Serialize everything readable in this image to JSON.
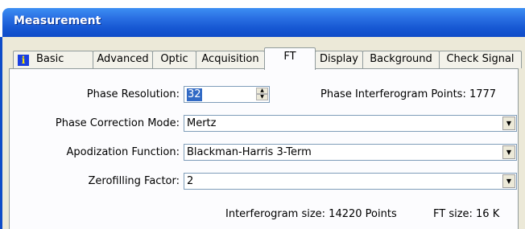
{
  "window": {
    "title": "Measurement"
  },
  "tabs": [
    {
      "label": "Basic"
    },
    {
      "label": "Advanced"
    },
    {
      "label": "Optic"
    },
    {
      "label": "Acquisition"
    },
    {
      "label": "FT"
    },
    {
      "label": "Display"
    },
    {
      "label": "Background"
    },
    {
      "label": "Check Signal"
    }
  ],
  "active_tab": "FT",
  "form": {
    "phase_resolution": {
      "label": "Phase Resolution:",
      "value": "32"
    },
    "phase_interferogram_points": "Phase Interferogram Points:  1777",
    "phase_correction_mode": {
      "label": "Phase Correction Mode:",
      "value": "Mertz"
    },
    "apodization_function": {
      "label": "Apodization Function:",
      "value": "Blackman-Harris 3-Term"
    },
    "zerofilling_factor": {
      "label": "Zerofilling Factor:",
      "value": "2"
    }
  },
  "status": {
    "interferogram_size": "Interferogram size: 14220 Points",
    "ft_size": "FT size: 16 K"
  },
  "icons": {
    "info": "i",
    "spin_up": "▲",
    "spin_down": "▼",
    "dropdown": "▼"
  },
  "colors": {
    "titlebar": "#1657d2",
    "dialog_bg": "#ece9d8",
    "panel_bg": "#fcfcfe",
    "selection": "#316ac5"
  }
}
